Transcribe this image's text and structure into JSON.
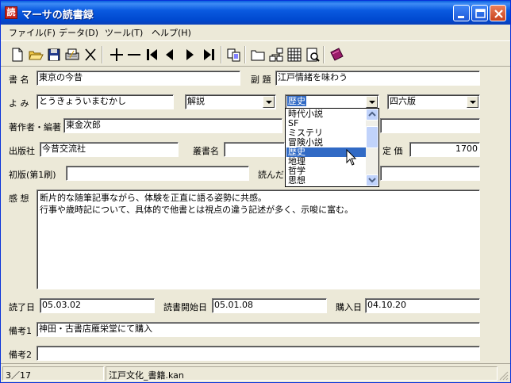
{
  "window": {
    "title": "マーサの読書録",
    "app_icon_glyph": "読",
    "controls": [
      "minimize",
      "maximize",
      "close"
    ]
  },
  "menu": [
    {
      "label": "ファイル(F)"
    },
    {
      "label": "データ(D)"
    },
    {
      "label": "ツール(T)"
    },
    {
      "label": "ヘルプ(H)"
    }
  ],
  "toolbar": {
    "icons": [
      "new-icon",
      "open-folder-icon",
      "save-icon",
      "print-icon",
      "delete-icon",
      "add-record-icon",
      "remove-record-icon",
      "first-record-icon",
      "prev-record-icon",
      "next-record-icon",
      "last-record-icon",
      "copy-icon",
      "folder-icon",
      "network-icon",
      "table-icon",
      "preview-icon",
      "book-icon"
    ]
  },
  "form": {
    "title_label": "書 名",
    "title_value": "東京の今昔",
    "subtitle_label": "副 題",
    "subtitle_value": "江戸情緒を味わう",
    "reading_label": "よ み",
    "reading_value": "とうきょういまむかし",
    "type_value": "解説",
    "genre_value": "歴史",
    "format_value": "四六版",
    "author_label": "著作者・編著",
    "author_value": "東金次郎",
    "publisher_label": "出版社",
    "publisher_value": "今昔交流社",
    "series_label": "叢書名",
    "series_value": "",
    "price_label": "定 価",
    "price_value": "1700",
    "first_edition_label": "初版(第1刷)",
    "first_edition_value": "",
    "read_count_label": "読んだ",
    "read_count_value": "",
    "impressions_label": "感 想",
    "impressions_lines": [
      "断片的な随筆記事ながら、体験を正直に語る姿勢に共感。",
      "行事や歳時記について、具体的で他書とは視点の違う記述が多く、示唆に富む。"
    ],
    "read_end_label": "読了日",
    "read_end_value": "05.03.02",
    "read_start_label": "読書開始日",
    "read_start_value": "05.01.08",
    "purchase_label": "購入日",
    "purchase_value": "04.10.20",
    "note1_label": "備考1",
    "note1_value": "神田・古書店雁栄堂にて購入",
    "note2_label": "備考2",
    "note2_value": ""
  },
  "genre_dropdown": {
    "items": [
      "時代小説",
      "SF",
      "ミステリ",
      "冒険小説",
      "歴史",
      "地理",
      "哲学",
      "思想"
    ],
    "selected": "歴史"
  },
  "status": {
    "record": "3／17",
    "file": "江戸文化_書籍.kan"
  }
}
